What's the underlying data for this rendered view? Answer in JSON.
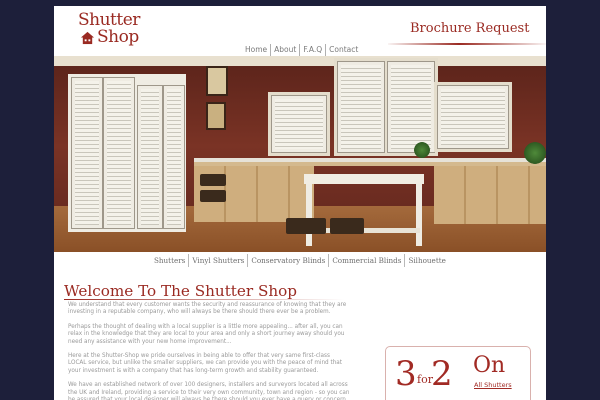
{
  "header": {
    "logo": {
      "top_text": "Shutter",
      "bottom_text": "Shop",
      "icon": "house-icon"
    },
    "brochure_label": "Brochure Request",
    "nav": [
      {
        "label": "Home"
      },
      {
        "label": "About"
      },
      {
        "label": "F.A.Q"
      },
      {
        "label": "Contact"
      }
    ]
  },
  "hero": {
    "image": "kitchen-with-shutters-photo"
  },
  "product_nav": [
    {
      "label": "Shutters"
    },
    {
      "label": "Vinyl Shutters"
    },
    {
      "label": "Conservatory Blinds"
    },
    {
      "label": "Commercial Blinds"
    },
    {
      "label": "Silhouette"
    }
  ],
  "main": {
    "heading": "Welcome To The Shutter Shop",
    "paragraphs": [
      "We understand that every customer wants the security and reassurance of knowing that they are investing in a reputable company, who will always be there should there ever be a problem.",
      "Perhaps the thought of dealing with a local supplier is a little more appealing... after all, you can relax in the knowledge that they are local to your area and only a short journey away should you need any assistance with your new home improvement...",
      "Here at the Shutter-Shop we pride ourselves in being able to offer that very same first-class LOCAL service, but unlike the smaller suppliers, we can provide you with the peace of mind that your investment is with a company that has long-term growth and stability guaranteed.",
      "We have an established network of over 100 designers, installers and surveyors located all across the UK and Ireland, providing a service to their very own community, town and region - so you can be assured that your local designer will always be there should you ever have a query or concern"
    ]
  },
  "promo": {
    "num1": "3",
    "for": "for",
    "num2": "2",
    "on": "On",
    "link": "All Shutters"
  },
  "colors": {
    "accent": "#9a2a22",
    "background": "#1d1f3a",
    "text": "#9a9a9a"
  }
}
